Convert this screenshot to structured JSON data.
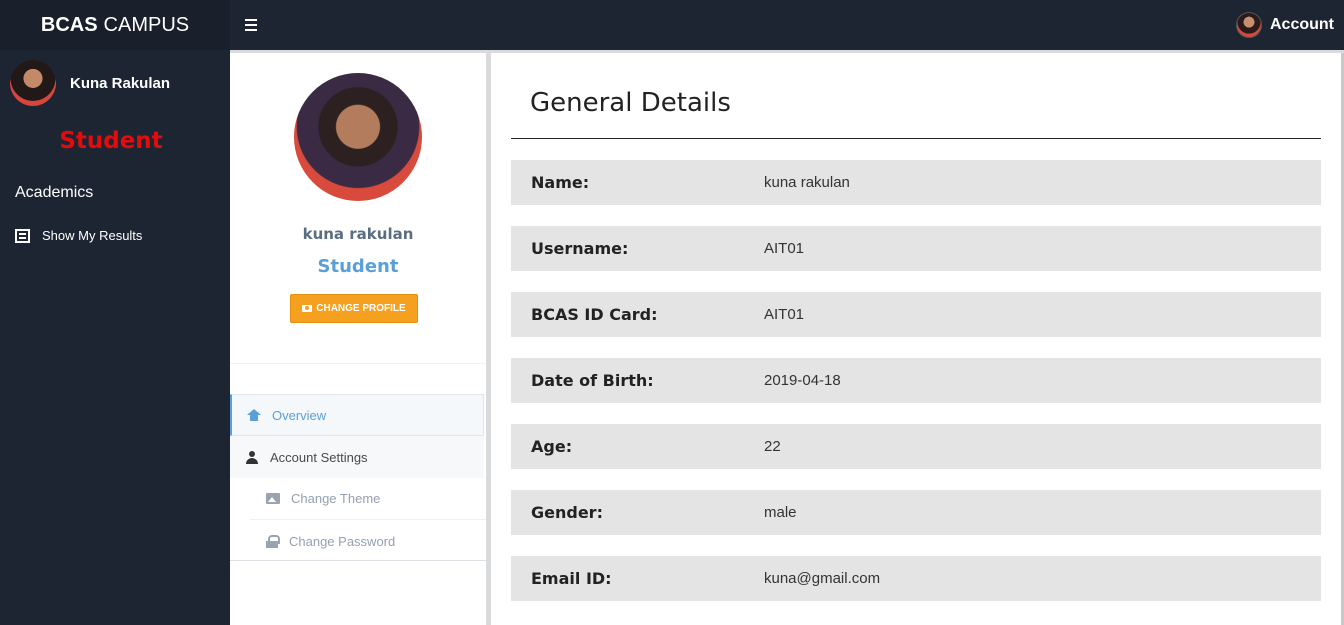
{
  "topbar": {
    "brand_bold": "BCAS",
    "brand_rest": "CAMPUS",
    "account_label": "Account"
  },
  "sidebar": {
    "user_name": "Kuna Rakulan",
    "role": "Student",
    "section": "Academics",
    "items": [
      {
        "label": "Show My Results",
        "icon": "list-icon"
      }
    ]
  },
  "profile": {
    "name": "kuna rakulan",
    "role": "Student",
    "change_button": "CHANGE PROFILE",
    "nav": [
      {
        "label": "Overview",
        "icon": "home-icon",
        "active": true
      },
      {
        "label": "Account Settings",
        "icon": "user-icon"
      },
      {
        "label": "Change Theme",
        "icon": "image-icon"
      },
      {
        "label": "Change Password",
        "icon": "lock-icon"
      }
    ]
  },
  "details": {
    "title": "General Details",
    "rows": [
      {
        "label": "Name:",
        "value": "kuna rakulan"
      },
      {
        "label": "Username:",
        "value": "AIT01"
      },
      {
        "label": "BCAS ID Card:",
        "value": "AIT01"
      },
      {
        "label": "Date of Birth:",
        "value": "2019-04-18"
      },
      {
        "label": "Age:",
        "value": "22"
      },
      {
        "label": "Gender:",
        "value": "male"
      },
      {
        "label": "Email ID:",
        "value": "kuna@gmail.com"
      }
    ]
  },
  "colors": {
    "navbar": "#1d2533",
    "role_red": "#e30b0b",
    "accent_blue": "#5a9fd6",
    "button_orange": "#f5a01f",
    "row_bg": "#e4e4e4"
  }
}
